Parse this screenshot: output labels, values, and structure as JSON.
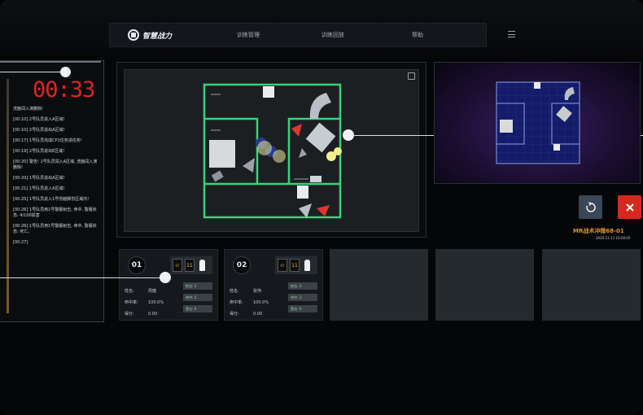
{
  "nav": {
    "brand": "智慧战力",
    "items": [
      "训练管理",
      "训练回放",
      "帮助"
    ]
  },
  "timer": "00:33",
  "log": [
    "洗脑闯入演删除!",
    "[00:10] 2号队员进入A区域!",
    "[00:10] 2号队员进出A区域!",
    "[00:17] 1号队员完成CP1住务进任务!",
    "[00:19] 2号队员进出E区域!",
    "[00:20] 警告! 1号队员闯入A区域, 洗脑闯入演删除!",
    "[00:20] 1号队员进出A区域!",
    "[00:21] 1号队员进入A区域!",
    "[00:25] 1号队员进入1号伤脑脚伤区域内!",
    "[00:26] 1号队员用1号警服射击, 命中, 警服状态: 4/100损害",
    "[00:26] 1号队员用1号警服射击, 命中, 警服状态: 死亡。",
    "[00:27]"
  ],
  "mission": {
    "name": "MR战术冲微68-01",
    "date": "2020-11-11 16:00:05"
  },
  "players": [
    {
      "num": "01",
      "mag": "07",
      "ammo": "11",
      "labels": [
        "姓名:",
        "命中率:",
        "得分:"
      ],
      "values": [
        "周健",
        "100.0%",
        "0.00"
      ],
      "pills": [
        "射击: 3",
        "命中: 3",
        "受击: 0"
      ]
    },
    {
      "num": "02",
      "mag": "07",
      "ammo": "11",
      "labels": [
        "姓名:",
        "命中率:",
        "得分:"
      ],
      "values": [
        "张伟",
        "100.0%",
        "0.00"
      ],
      "pills": [
        "射击: 3",
        "命中: 3",
        "受击: 0"
      ]
    }
  ],
  "colors": {
    "accent_red": "#e02424",
    "room_green": "#38d27a",
    "mission_orange": "#e0962a",
    "close_red": "#d5291f",
    "reset_blue": "#3a4756"
  },
  "icons": [
    "menu-icon",
    "expand-icon",
    "reset-icon",
    "close-icon",
    "logo-icon"
  ]
}
